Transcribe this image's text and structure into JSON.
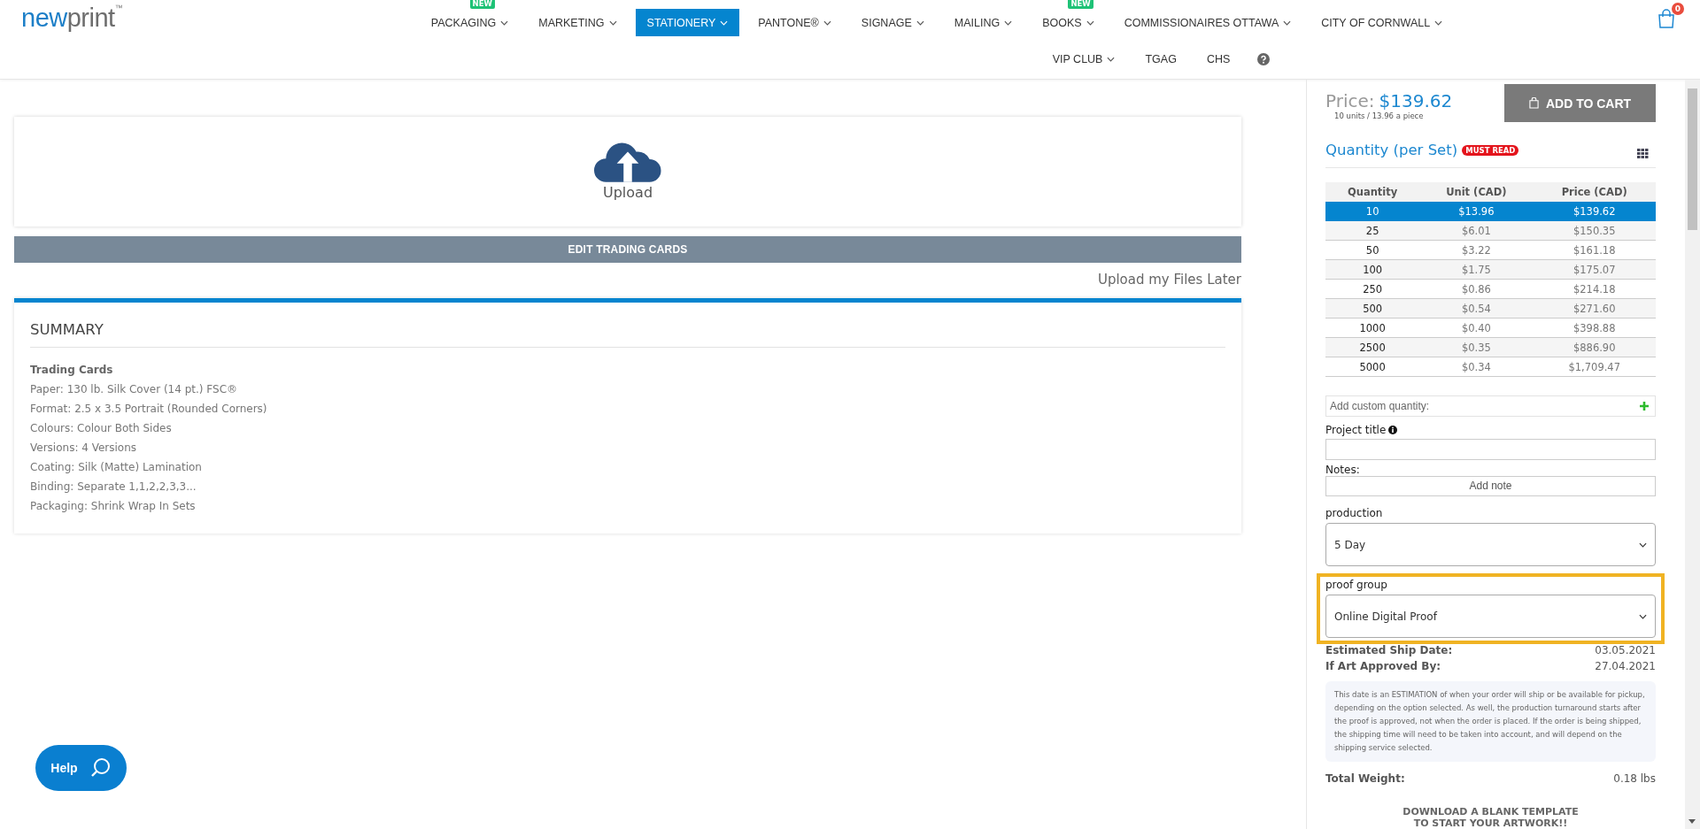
{
  "header": {
    "logo": {
      "first": "new",
      "second": "print",
      "mark": "™"
    },
    "nav": [
      {
        "label": "PACKAGING",
        "dropdown": true,
        "badge": "NEW",
        "selected": false
      },
      {
        "label": "MARKETING",
        "dropdown": true,
        "selected": false
      },
      {
        "label": "STATIONERY",
        "dropdown": true,
        "selected": true
      },
      {
        "label": "PANTONE®",
        "dropdown": true,
        "selected": false
      },
      {
        "label": "SIGNAGE",
        "dropdown": true,
        "selected": false
      },
      {
        "label": "MAILING",
        "dropdown": true,
        "selected": false
      },
      {
        "label": "BOOKS",
        "dropdown": true,
        "badge": "NEW",
        "selected": false
      },
      {
        "label": "COMMISSIONAIRES OTTAWA",
        "dropdown": true,
        "selected": false
      },
      {
        "label": "CITY OF CORNWALL",
        "dropdown": true,
        "selected": false
      }
    ],
    "nav_row_2": [
      {
        "label": "VIP CLUB",
        "dropdown": true,
        "selected": false
      },
      {
        "label": "TGAG",
        "dropdown": false,
        "selected": false
      },
      {
        "label": "CHS",
        "dropdown": false,
        "selected": false
      }
    ],
    "cart": {
      "count": "0"
    }
  },
  "upload": {
    "label": "Upload"
  },
  "edit_button": "EDIT TRADING CARDS",
  "upload_later": "Upload my Files Later",
  "summary": {
    "title": "SUMMARY",
    "product": "Trading Cards",
    "lines": [
      "Paper: 130 lb. Silk Cover (14 pt.) FSC®",
      "Format: 2.5 x 3.5 Portrait (Rounded Corners)",
      "Colours: Colour Both Sides",
      "Versions: 4 Versions",
      "Coating: Silk (Matte) Lamination",
      "Binding: Separate 1,1,2,2,3,3...",
      "Packaging: Shrink Wrap In Sets"
    ]
  },
  "order": {
    "price_label": "Price:",
    "price": "$139.62",
    "price_note": "10 units / 13.96 a piece",
    "add_to_cart": "ADD TO CART",
    "quantity_title": "Quantity (per Set)",
    "must_read": "MUST READ",
    "table": {
      "columns": [
        "Quantity",
        "Unit (CAD)",
        "Price (CAD)"
      ],
      "rows": [
        {
          "cells": [
            "10",
            "$13.96",
            "$139.62"
          ],
          "selected": true
        },
        {
          "cells": [
            "25",
            "$6.01",
            "$150.35"
          ],
          "selected": false
        },
        {
          "cells": [
            "50",
            "$3.22",
            "$161.18"
          ],
          "selected": false
        },
        {
          "cells": [
            "100",
            "$1.75",
            "$175.07"
          ],
          "selected": false
        },
        {
          "cells": [
            "250",
            "$0.86",
            "$214.18"
          ],
          "selected": false
        },
        {
          "cells": [
            "500",
            "$0.54",
            "$271.60"
          ],
          "selected": false
        },
        {
          "cells": [
            "1000",
            "$0.40",
            "$398.88"
          ],
          "selected": false
        },
        {
          "cells": [
            "2500",
            "$0.35",
            "$886.90"
          ],
          "selected": false
        },
        {
          "cells": [
            "5000",
            "$0.34",
            "$1,709.47"
          ],
          "selected": false
        }
      ]
    },
    "custom_quantity": {
      "placeholder": "Add custom quantity:"
    },
    "project_title": {
      "label": "Project title"
    },
    "notes": {
      "label": "Notes:",
      "button": "Add note"
    },
    "selects": [
      {
        "label": "production",
        "value": "5 Day",
        "highlighted": false
      },
      {
        "label": "proof group",
        "value": "Online Digital Proof",
        "highlighted": true
      }
    ],
    "dates": [
      {
        "label": "Estimated Ship Date:",
        "value": "03.05.2021"
      },
      {
        "label": "If Art Approved By:",
        "value": "27.04.2021"
      }
    ],
    "info": "This date is an ESTIMATION of when your order will ship or be available for pickup, depending on the option selected. As well, the production turnaround starts after the proof is approved, not when the order is placed. If the order is being shipped, the shipping time will need to be taken into account, and will depend on the shipping service selected.",
    "weight": {
      "label": "Total Weight:",
      "value": "0.18 lbs"
    },
    "download": [
      "DOWNLOAD A BLANK TEMPLATE",
      "TO START YOUR ARTWORK!!"
    ]
  },
  "help_button": "Help"
}
